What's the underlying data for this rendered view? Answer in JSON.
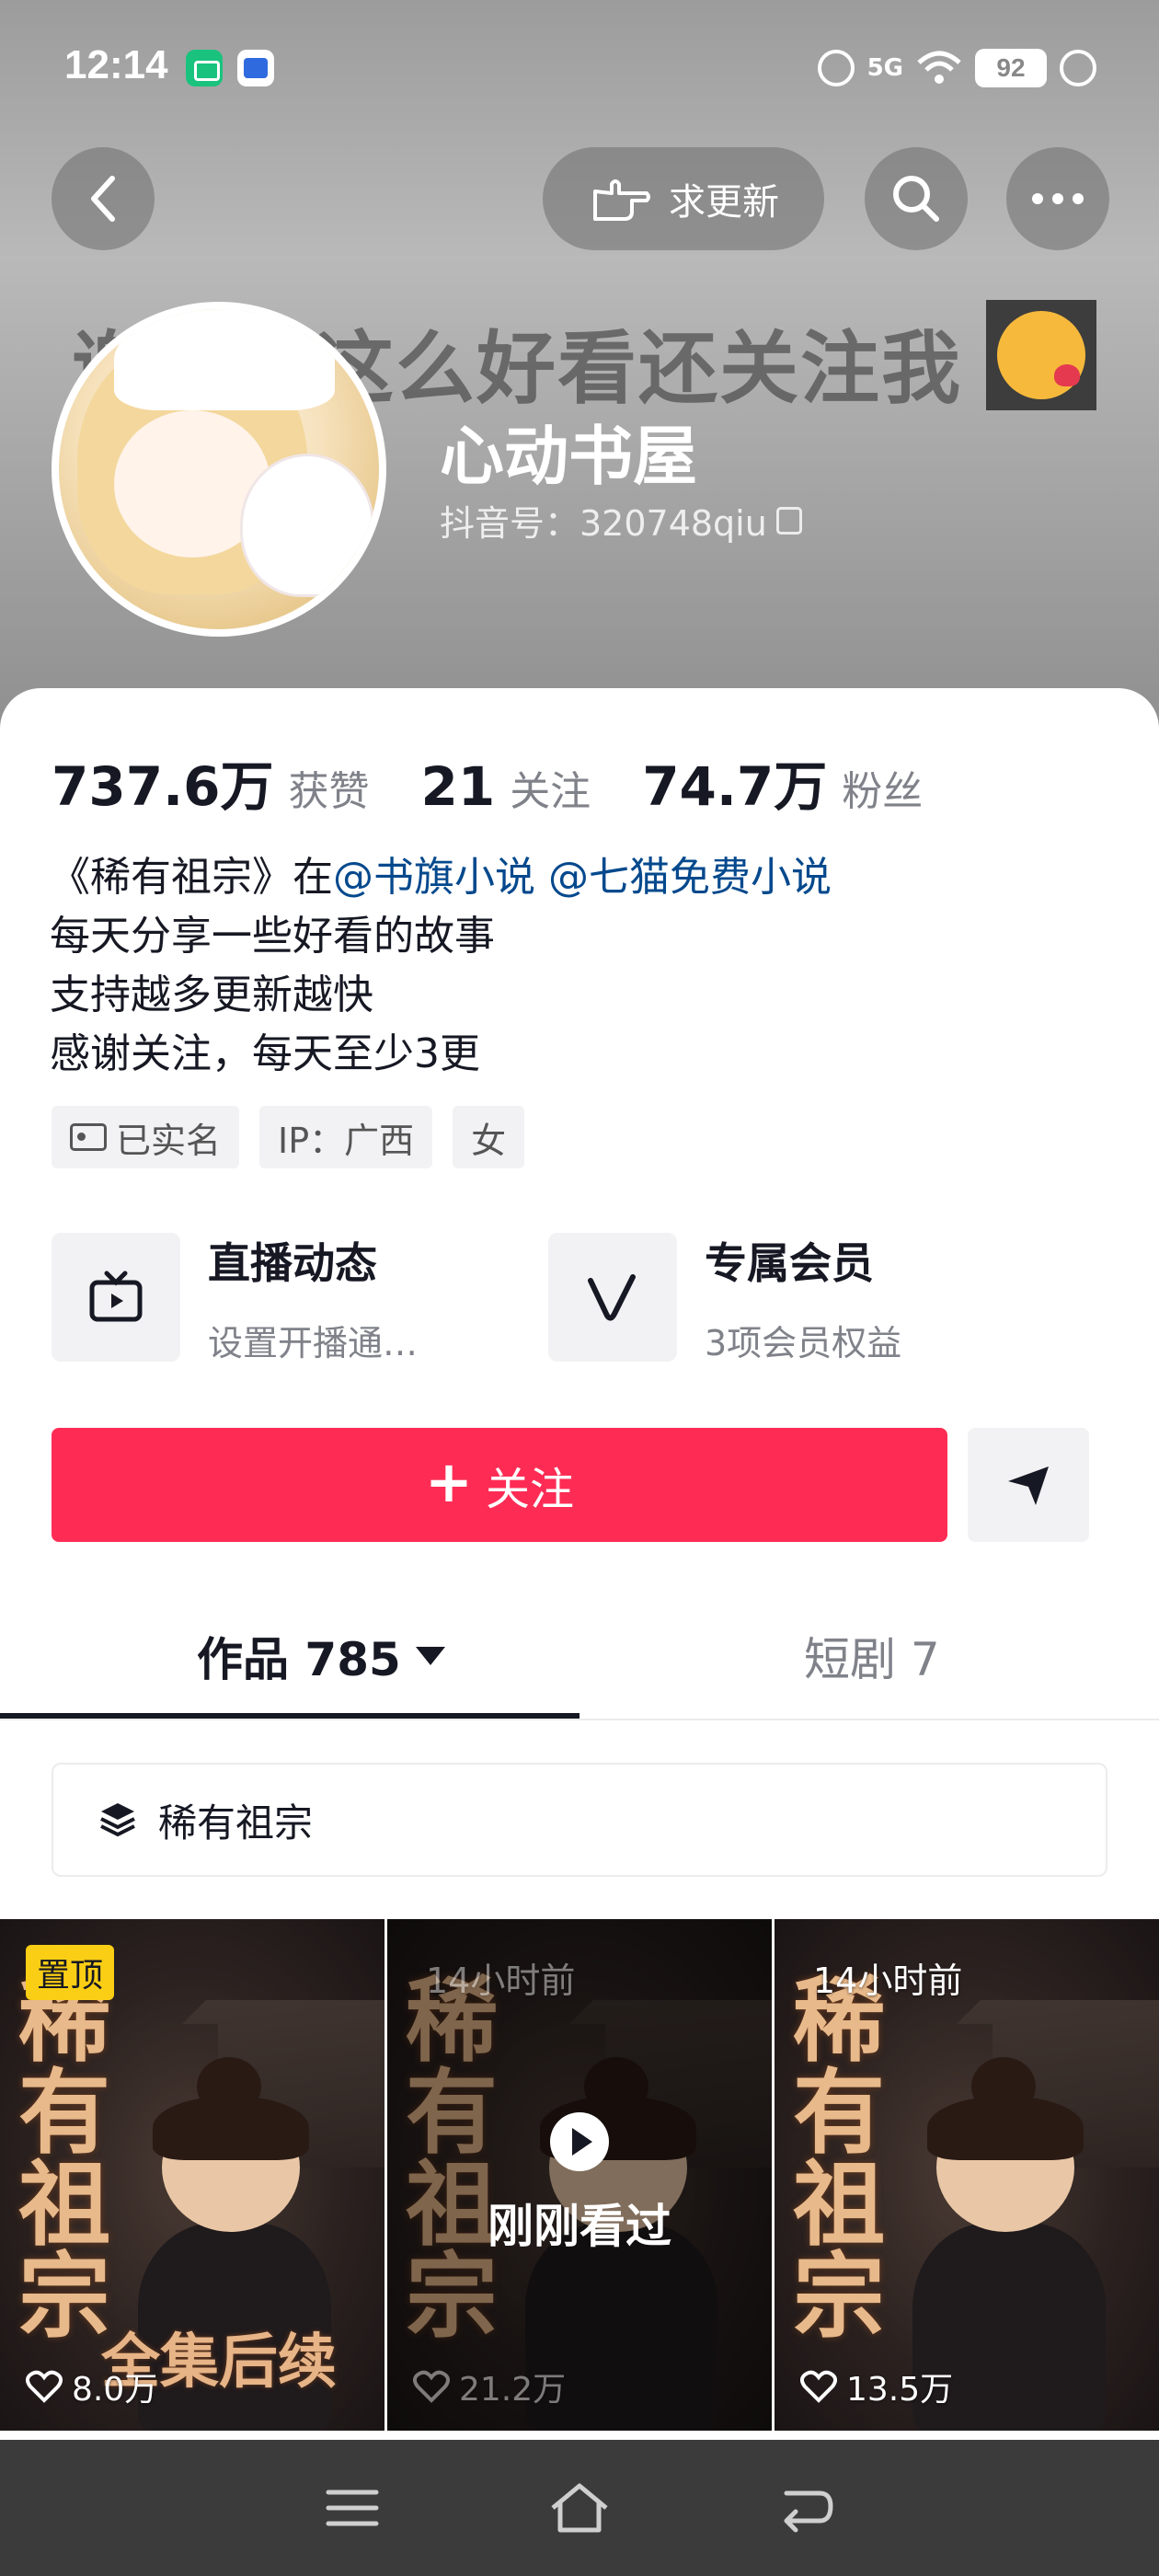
{
  "status_bar": {
    "time": "12:14",
    "network": "5G",
    "battery": "92"
  },
  "top_nav": {
    "request_update_label": "求更新"
  },
  "banner": {
    "text": "谢谢你这么好看还关注我"
  },
  "profile": {
    "name": "心动书屋",
    "douyin_id": "抖音号：320748qiu"
  },
  "stats": {
    "likes_value": "737.6万",
    "likes_label": "获赞",
    "following_value": "21",
    "following_label": "关注",
    "followers_value": "74.7万",
    "followers_label": "粉丝"
  },
  "bio": {
    "line1_prefix": "《稀有祖宗》在",
    "mention1": "@书旗小说",
    "mention2": "@七猫免费小说",
    "line2": "每天分享一些好看的故事",
    "line3": "支持越多更新越快",
    "line4": "感谢关注，每天至少3更"
  },
  "tags": {
    "verified": "已实名",
    "ip": "IP：广西",
    "gender": "女"
  },
  "features": {
    "live_title": "直播动态",
    "live_sub": "设置开播通…",
    "vip_title": "专属会员",
    "vip_sub": "3项会员权益"
  },
  "actions": {
    "follow_label": "关注"
  },
  "tabs": {
    "works_label": "作品 785",
    "drama_label": "短剧 7"
  },
  "collection": {
    "label": "稀有祖宗"
  },
  "videos": [
    {
      "badge": "置顶",
      "cover_title": "稀有祖宗",
      "cover_subtitle": "全集后续",
      "likes": "8.0万"
    },
    {
      "time": "14小时前",
      "cover_title": "稀有祖宗",
      "overlay": "刚刚看过",
      "likes": "21.2万"
    },
    {
      "time": "14小时前",
      "cover_title": "稀有祖宗",
      "likes": "13.5万"
    }
  ],
  "colors": {
    "follow_button": "#fe2c55",
    "mention": "#04498d",
    "pin_badge": "#face15"
  },
  "icons": {
    "back": "back-arrow-icon",
    "request_update": "pointing-hand-icon",
    "search": "search-icon",
    "more": "more-dots-icon",
    "live": "tv-icon",
    "vip": "v-icon",
    "share": "send-icon",
    "collection": "layers-icon",
    "like": "heart-icon",
    "sys_menu": "menu-icon",
    "sys_home": "home-icon",
    "sys_back": "return-icon"
  }
}
